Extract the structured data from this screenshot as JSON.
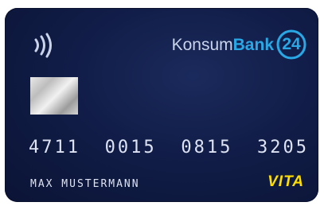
{
  "brand": {
    "prefix": "Konsum",
    "suffix": "Bank",
    "badge": "24"
  },
  "card": {
    "number_groups": [
      "4711",
      "0015",
      "0815",
      "3205"
    ],
    "holder_name": "MAX MUSTERMANN",
    "product_name": "VITA"
  },
  "colors": {
    "card_background": "#111d48",
    "brand_accent": "#29a8e6",
    "product_label": "#ffde00",
    "embossed_text": "#dde3f2"
  },
  "icons": {
    "contactless": "contactless-icon",
    "chip": "chip-icon"
  }
}
